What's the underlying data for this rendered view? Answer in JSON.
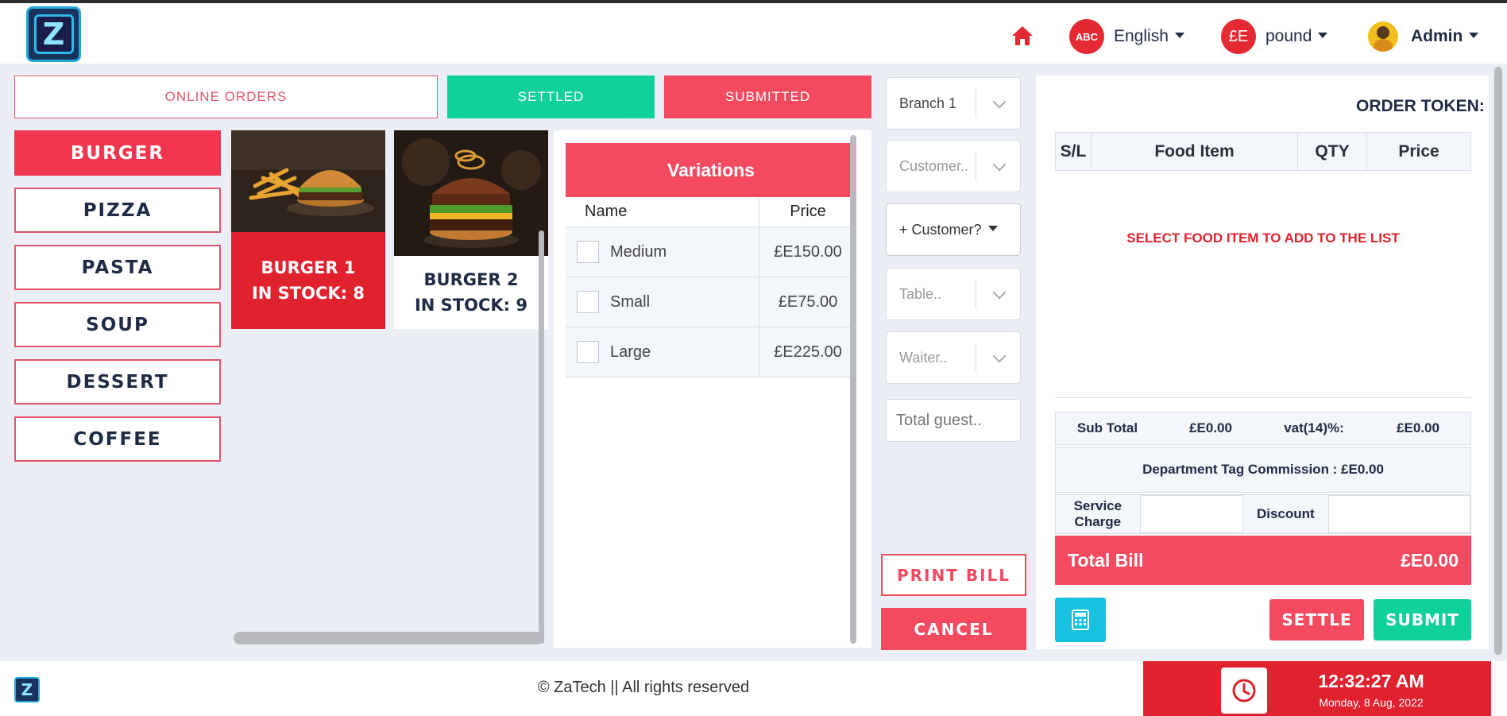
{
  "header": {
    "home_icon": "home-icon",
    "language_badge": "ABC",
    "language_label": "English",
    "currency_badge": "£E",
    "currency_label": "pound",
    "user_label": "Admin"
  },
  "tabs": {
    "online_orders": "ONLINE ORDERS",
    "settled": "SETTLED",
    "submitted": "SUBMITTED"
  },
  "categories": [
    "BURGER",
    "PIZZA",
    "PASTA",
    "SOUP",
    "DESSERT",
    "COFFEE"
  ],
  "foods": [
    {
      "name": "BURGER 1",
      "stock": "IN STOCK: 8"
    },
    {
      "name": "BURGER 2",
      "stock": "IN STOCK: 9"
    }
  ],
  "variations": {
    "title": "Variations",
    "col_name": "Name",
    "col_price": "Price",
    "rows": [
      {
        "name": "Medium",
        "price": "£E150.00"
      },
      {
        "name": "Small",
        "price": "£E75.00"
      },
      {
        "name": "Large",
        "price": "£E225.00"
      }
    ]
  },
  "form": {
    "branch": "Branch 1",
    "customer_placeholder": "Customer..",
    "add_customer": "+ Customer?",
    "table_placeholder": "Table..",
    "waiter_placeholder": "Waiter..",
    "guests_placeholder": "Total guest..",
    "print_bill": "PRINT BILL",
    "cancel": "CANCEL"
  },
  "order": {
    "token_label": "ORDER TOKEN:",
    "col_sl": "S/L",
    "col_food": "Food Item",
    "col_qty": "QTY",
    "col_price": "Price",
    "empty_message": "SELECT FOOD ITEM TO ADD TO THE LIST",
    "subtotal_label": "Sub Total",
    "subtotal_value": "£E0.00",
    "vat_label": "vat(14)%:",
    "vat_value": "£E0.00",
    "dept_commission": "Department Tag Commission : £E0.00",
    "service_charge_label": "Service Charge",
    "discount_label": "Discount",
    "total_label": "Total Bill",
    "total_value": "£E0.00",
    "settle": "SETTLE",
    "submit": "SUBMIT"
  },
  "footer": {
    "copyright": "© ZaTech || All rights reserved",
    "time": "12:32:27 AM",
    "date": "Monday, 8 Aug, 2022"
  },
  "colors": {
    "accent_red": "#f34a5f",
    "accent_green": "#10d19a",
    "accent_cyan": "#17c1e0",
    "clock_red": "#e0222e"
  }
}
